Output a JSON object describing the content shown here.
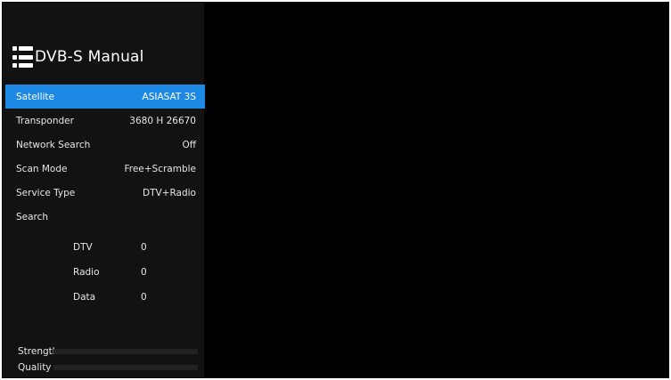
{
  "header": {
    "title": "DVB-S Manual",
    "icon": "list-menu-icon"
  },
  "settings": [
    {
      "label": "Satellite",
      "value": "ASIASAT 3S",
      "selected": true
    },
    {
      "label": "Transponder",
      "value": "3680 H 26670",
      "selected": false
    },
    {
      "label": "Network Search",
      "value": "Off",
      "selected": false
    },
    {
      "label": "Scan Mode",
      "value": "Free+Scramble",
      "selected": false
    },
    {
      "label": "Service Type",
      "value": "DTV+Radio",
      "selected": false
    },
    {
      "label": "Search",
      "value": "",
      "selected": false
    }
  ],
  "counts": [
    {
      "label": "DTV",
      "value": "0"
    },
    {
      "label": "Radio",
      "value": "0"
    },
    {
      "label": "Data",
      "value": "0"
    }
  ],
  "meters": {
    "strength": {
      "label": "Strength",
      "level": 0
    },
    "quality": {
      "label": "Quality",
      "level": 0
    }
  },
  "colors": {
    "selected": "#1e88e5",
    "panel": "#121212",
    "background": "#000000"
  }
}
